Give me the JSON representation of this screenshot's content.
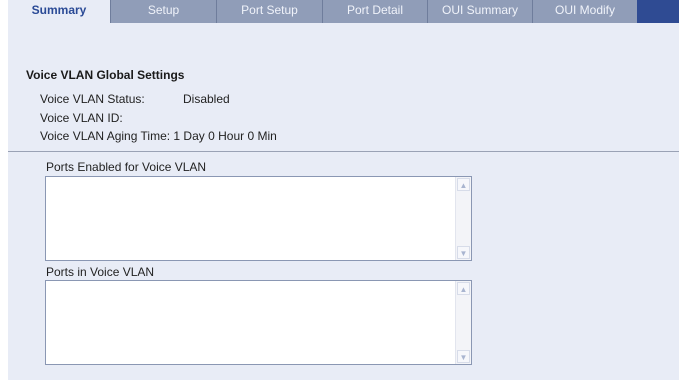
{
  "tabs": [
    {
      "label": "Summary",
      "active": true
    },
    {
      "label": "Setup",
      "active": false
    },
    {
      "label": "Port Setup",
      "active": false
    },
    {
      "label": "Port Detail",
      "active": false
    },
    {
      "label": "OUI Summary",
      "active": false
    },
    {
      "label": "OUI Modify",
      "active": false
    }
  ],
  "section_title": "Voice VLAN Global Settings",
  "settings": {
    "status_label": "Voice VLAN Status:",
    "status_value": "Disabled",
    "id_label": "Voice VLAN ID:",
    "id_value": "",
    "aging_label": "Voice VLAN Aging Time:",
    "aging_value": "1 Day 0 Hour 0 Min"
  },
  "ports_enabled": {
    "label": "Ports Enabled for Voice VLAN",
    "items": []
  },
  "ports_in_vlan": {
    "label": "Ports in Voice VLAN",
    "items": []
  },
  "colors": {
    "tab_bar": "#2f4b93",
    "tab_inactive": "#909db8",
    "panel_bg": "#e8ecf6",
    "active_tab_text": "#2a4a96"
  }
}
